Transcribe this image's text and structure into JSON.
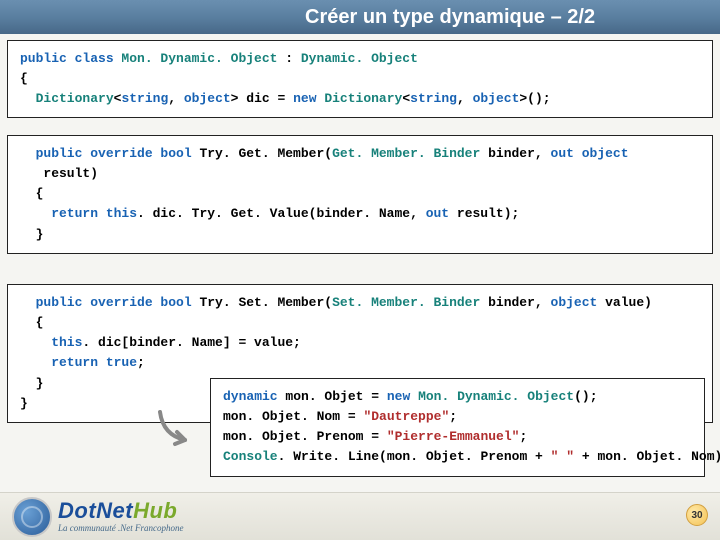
{
  "title": "Créer  un type dynamique – 2/2",
  "box1": {
    "l1_a": "public class ",
    "l1_b": "Mon. Dynamic. Object ",
    "l1_c": ": ",
    "l1_d": "Dynamic. Object",
    "l2": "{",
    "l3_a": "  Dictionary",
    "l3_b": "<",
    "l3_c": "string",
    "l3_d": ", ",
    "l3_e": "object",
    "l3_f": "> dic = ",
    "l3_g": "new ",
    "l3_h": "Dictionary",
    "l3_i": "<",
    "l3_j": "string",
    "l3_k": ", ",
    "l3_l": "object",
    "l3_m": ">();"
  },
  "box2": {
    "l1_a": "  public override bool ",
    "l1_b": "Try. Get. Member(",
    "l1_c": "Get. Member. Binder ",
    "l1_d": "binder, ",
    "l1_e": "out object",
    "l2": "   result)",
    "l3": "  {",
    "l4_a": "    return this",
    "l4_b": ". dic. Try. Get. Value(binder. Name, ",
    "l4_c": "out ",
    "l4_d": "result);",
    "l5": "  }"
  },
  "box3": {
    "l1_a": "  public override bool ",
    "l1_b": "Try. Set. Member(",
    "l1_c": "Set. Member. Binder ",
    "l1_d": "binder, ",
    "l1_e": "object ",
    "l1_f": "value)",
    "l2": "  {",
    "l3_a": "    this",
    "l3_b": ". dic[binder. Name] = value;",
    "l4_a": "    return true",
    "l4_b": ";",
    "l5": "  }",
    "l6": "}"
  },
  "box4": {
    "l1_a": "dynamic ",
    "l1_b": "mon. Objet = ",
    "l1_c": "new ",
    "l1_d": "Mon. Dynamic. Object",
    "l1_e": "();",
    "l2_a": "mon. Objet. Nom = ",
    "l2_b": "\"Dautreppe\"",
    "l2_c": ";",
    "l3_a": "mon. Objet. Prenom = ",
    "l3_b": "\"Pierre-Emmanuel\"",
    "l3_c": ";",
    "l4_a": "Console",
    "l4_b": ". Write. Line(mon. Objet. Prenom + ",
    "l4_c": "\" \" ",
    "l4_d": "+ mon. Objet. Nom);"
  },
  "footer": {
    "logo_main_1": "DotNet",
    "logo_main_2": "Hub",
    "logo_sub": "La communauté .Net Francophone",
    "slide_number": "30"
  }
}
